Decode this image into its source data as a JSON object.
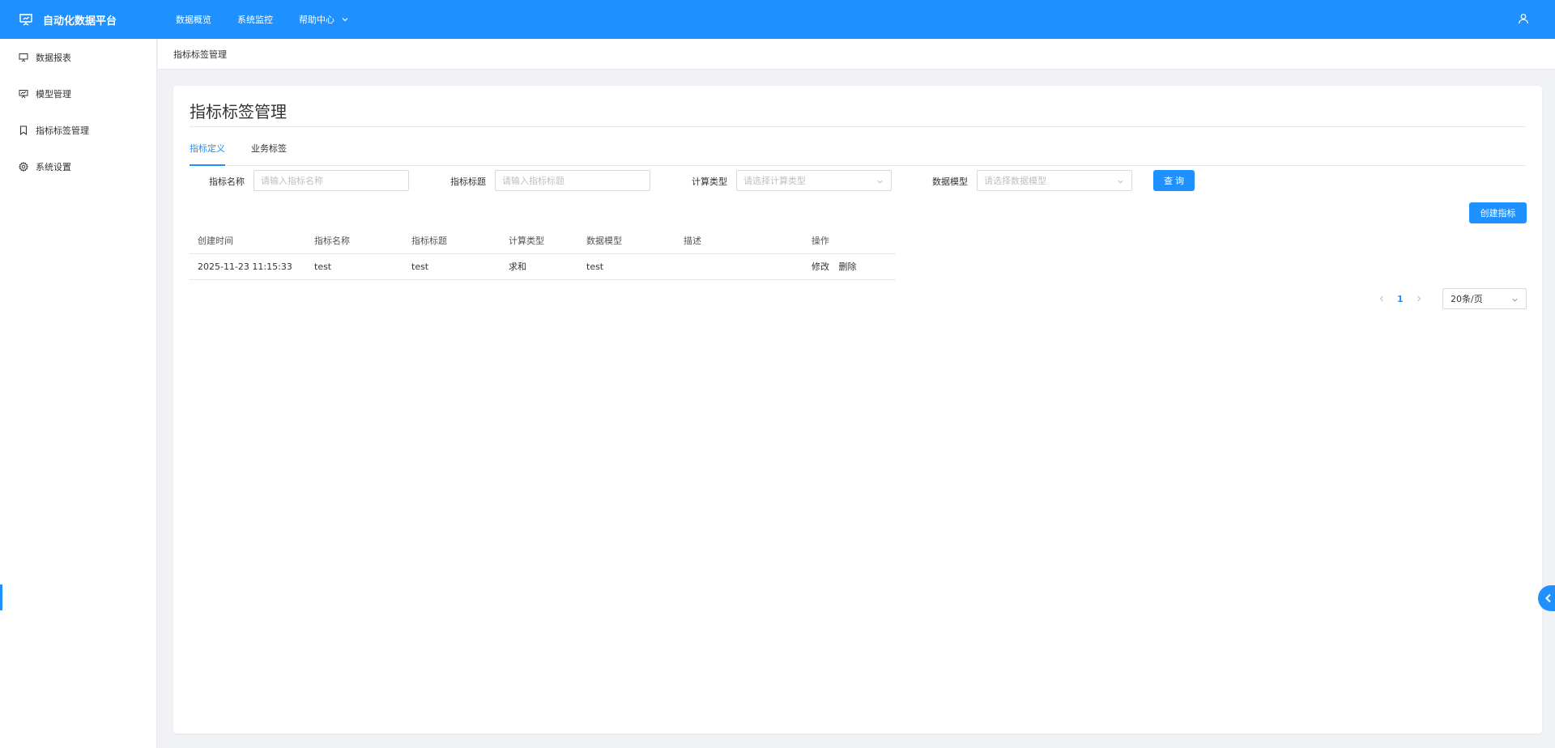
{
  "app": {
    "title": "自动化数据平台",
    "accent_color": "#1e90ff",
    "brand_icon": "presentation-board-icon",
    "user_icon": "user-icon"
  },
  "topnav": {
    "items": [
      {
        "label": "数据概览"
      },
      {
        "label": "系统监控"
      },
      {
        "label": "帮助中心",
        "icon": "chevron-down-icon"
      }
    ]
  },
  "sidebar": {
    "items": [
      {
        "label": "数据报表",
        "icon": "presentation-board-icon"
      },
      {
        "label": "模型管理",
        "icon": "presentation-board-icon"
      },
      {
        "label": "指标标签管理",
        "icon": "bookmark-icon"
      },
      {
        "label": "系统设置",
        "icon": "gear-icon"
      }
    ]
  },
  "breadcrumb": {
    "current": "指标标签管理"
  },
  "page": {
    "title": "指标标签管理",
    "tabs": [
      {
        "label": "指标定义",
        "active": true
      },
      {
        "label": "业务标签",
        "active": false
      }
    ]
  },
  "filters": {
    "name": {
      "label": "指标名称",
      "placeholder": "请输入指标名称"
    },
    "title": {
      "label": "指标标题",
      "placeholder": "请输入指标标题"
    },
    "calc_type": {
      "label": "计算类型",
      "placeholder": "请选择计算类型"
    },
    "data_model": {
      "label": "数据模型",
      "placeholder": "请选择数据模型"
    },
    "query_label": "查 询"
  },
  "actions": {
    "create_label": "创建指标"
  },
  "table": {
    "headers": [
      "创建时间",
      "指标名称",
      "指标标题",
      "计算类型",
      "数据模型",
      "描述",
      "操作"
    ],
    "rows": [
      {
        "created": "2025-11-23 11:15:33",
        "name": "test",
        "title": "test",
        "calc_type": "求和",
        "model": "test",
        "desc": "",
        "edit": "修改",
        "delete": "删除"
      }
    ]
  },
  "pagination": {
    "current_page": "1",
    "page_size": "20条/页"
  }
}
